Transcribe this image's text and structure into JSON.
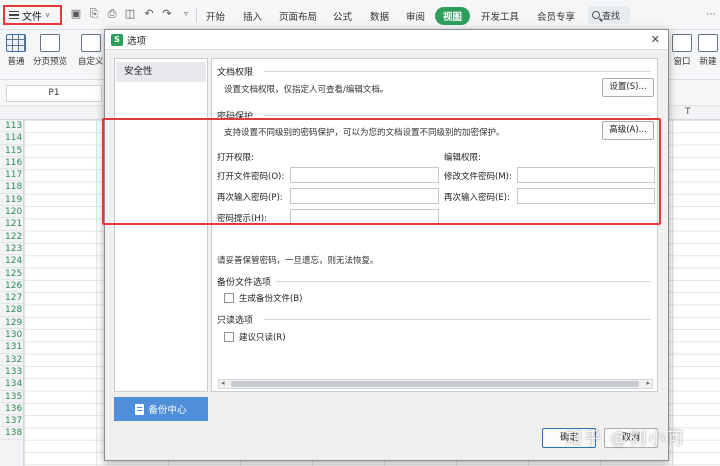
{
  "menubar": {
    "file_label": "文件",
    "tabs": [
      "开始",
      "插入",
      "页面布局",
      "公式",
      "数据",
      "审阅",
      "视图",
      "开发工具",
      "会员专享"
    ],
    "active_tab": "视图",
    "search_label": "查找"
  },
  "ribbon": {
    "items": [
      "普通",
      "分页预览",
      "自定义",
      "窗口",
      "新建"
    ]
  },
  "formula_bar": {
    "cell_ref": "P1"
  },
  "sheet": {
    "column_label": "T",
    "row_numbers": [
      "113",
      "114",
      "115",
      "116",
      "117",
      "118",
      "119",
      "120",
      "121",
      "122",
      "123",
      "124",
      "125",
      "126",
      "127",
      "128",
      "129",
      "130",
      "131",
      "132",
      "133",
      "134",
      "135",
      "136",
      "137",
      "138"
    ]
  },
  "dialog": {
    "title": "选项",
    "category": "安全性",
    "backup_center": "备份中心",
    "doc_rights": {
      "heading": "文档权限",
      "desc": "设置文档权限，仅指定人可查看/编辑文档。",
      "button": "设置(S)..."
    },
    "password": {
      "heading": "密码保护",
      "desc": "支持设置不同级别的密码保护，可以为您的文档设置不同级别的加密保护。",
      "button": "高级(A)...",
      "open_rights": "打开权限:",
      "edit_rights": "编辑权限:",
      "open_pw": "打开文件密码(O):",
      "open_pw_value": "",
      "reenter_open": "再次输入密码(P):",
      "reenter_open_value": "",
      "hint": "密码提示(H):",
      "hint_value": "",
      "modify_pw": "修改文件密码(M):",
      "modify_pw_value": "",
      "reenter_modify": "再次输入密码(E):",
      "reenter_modify_value": ""
    },
    "notice": "请妥善保管密码，一旦遗忘，则无法恢复。",
    "backup": {
      "heading": "备份文件选项",
      "option": "生成备份文件(B)"
    },
    "readonly": {
      "heading": "只读选项",
      "option": "建议只读(R)"
    },
    "ok": "确定",
    "cancel": "取消"
  },
  "watermark": "知乎 @刘小可",
  "colors": {
    "accent_green": "#2e9e5d",
    "highlight_red": "#e23a3a",
    "backup_blue": "#4f8ed8"
  }
}
